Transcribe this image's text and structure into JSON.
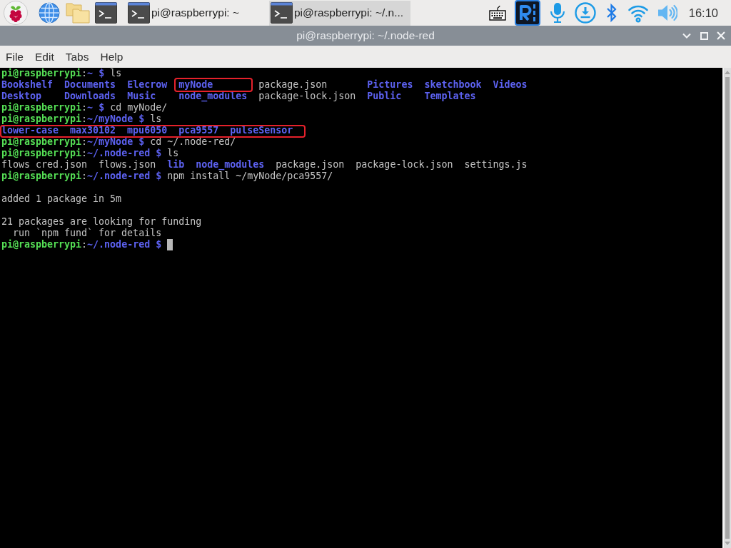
{
  "taskbar": {
    "windows": [
      {
        "label": "pi@raspberrypi: ~",
        "selected": false
      },
      {
        "label": "pi@raspberrypi: ~/.n...",
        "selected": true
      }
    ],
    "clock": "16:10"
  },
  "window": {
    "title": "pi@raspberrypi: ~/.node-red",
    "menu": [
      "File",
      "Edit",
      "Tabs",
      "Help"
    ]
  },
  "terminal": {
    "lines": [
      {
        "kind": "prompt",
        "highlighted": false,
        "prompt": {
          "user_host": "pi@raspberrypi",
          "separator": ":",
          "path": "~",
          "symbol": "$"
        },
        "command": "ls",
        "cursor": false
      },
      {
        "kind": "listing",
        "highlighted": false,
        "rows": [
          [
            {
              "name": "Bookshelf",
              "kind": "dir",
              "highlighted": false
            },
            {
              "name": "Documents",
              "kind": "dir",
              "highlighted": false
            },
            {
              "name": "Elecrow",
              "kind": "dir",
              "highlighted": false
            },
            {
              "name": "myNode",
              "kind": "dir",
              "highlighted": true
            },
            {
              "name": "package.json",
              "kind": "file",
              "highlighted": false
            },
            {
              "name": "Pictures",
              "kind": "dir",
              "highlighted": false
            },
            {
              "name": "sketchbook",
              "kind": "dir",
              "highlighted": false
            },
            {
              "name": "Videos",
              "kind": "dir",
              "highlighted": false
            }
          ],
          [
            {
              "name": "Desktop",
              "kind": "dir",
              "highlighted": false
            },
            {
              "name": "Downloads",
              "kind": "dir",
              "highlighted": false
            },
            {
              "name": "Music",
              "kind": "dir",
              "highlighted": false
            },
            {
              "name": "node_modules",
              "kind": "dir",
              "highlighted": false
            },
            {
              "name": "package-lock.json",
              "kind": "file",
              "highlighted": false
            },
            {
              "name": "Public",
              "kind": "dir",
              "highlighted": false
            },
            {
              "name": "Templates",
              "kind": "dir",
              "highlighted": false
            }
          ]
        ]
      },
      {
        "kind": "prompt",
        "highlighted": false,
        "prompt": {
          "user_host": "pi@raspberrypi",
          "separator": ":",
          "path": "~",
          "symbol": "$"
        },
        "command": "cd myNode/",
        "cursor": false
      },
      {
        "kind": "prompt",
        "highlighted": false,
        "prompt": {
          "user_host": "pi@raspberrypi",
          "separator": ":",
          "path": "~/myNode",
          "symbol": "$"
        },
        "command": "ls",
        "cursor": false
      },
      {
        "kind": "listing",
        "highlighted": true,
        "rows": [
          [
            {
              "name": "lower-case",
              "kind": "dir",
              "highlighted": false
            },
            {
              "name": "max30102",
              "kind": "dir",
              "highlighted": false
            },
            {
              "name": "mpu6050",
              "kind": "dir",
              "highlighted": false
            },
            {
              "name": "pca9557",
              "kind": "dir",
              "highlighted": false
            },
            {
              "name": "pulseSensor",
              "kind": "dir",
              "highlighted": false
            }
          ]
        ]
      },
      {
        "kind": "prompt",
        "highlighted": false,
        "prompt": {
          "user_host": "pi@raspberrypi",
          "separator": ":",
          "path": "~/myNode",
          "symbol": "$"
        },
        "command": "cd ~/.node-red/",
        "cursor": false
      },
      {
        "kind": "prompt",
        "highlighted": false,
        "prompt": {
          "user_host": "pi@raspberrypi",
          "separator": ":",
          "path": "~/.node-red",
          "symbol": "$"
        },
        "command": "ls",
        "cursor": false
      },
      {
        "kind": "listing",
        "highlighted": false,
        "rows": [
          [
            {
              "name": "flows_cred.json",
              "kind": "file",
              "highlighted": false
            },
            {
              "name": "flows.json",
              "kind": "file",
              "highlighted": false
            },
            {
              "name": "lib",
              "kind": "dir",
              "highlighted": false
            },
            {
              "name": "node_modules",
              "kind": "dir",
              "highlighted": false
            },
            {
              "name": "package.json",
              "kind": "file",
              "highlighted": false
            },
            {
              "name": "package-lock.json",
              "kind": "file",
              "highlighted": false
            },
            {
              "name": "settings.js",
              "kind": "file",
              "highlighted": false
            }
          ]
        ]
      },
      {
        "kind": "prompt",
        "highlighted": false,
        "prompt": {
          "user_host": "pi@raspberrypi",
          "separator": ":",
          "path": "~/.node-red",
          "symbol": "$"
        },
        "command": "npm install ~/myNode/pca9557/",
        "cursor": false
      },
      {
        "kind": "blank",
        "highlighted": false
      },
      {
        "kind": "output",
        "highlighted": false,
        "text": "added 1 package in 5m"
      },
      {
        "kind": "blank",
        "highlighted": false
      },
      {
        "kind": "output",
        "highlighted": false,
        "text": "21 packages are looking for funding"
      },
      {
        "kind": "output",
        "highlighted": false,
        "text": "  run `npm fund` for details"
      },
      {
        "kind": "prompt",
        "highlighted": false,
        "prompt": {
          "user_host": "pi@raspberrypi",
          "separator": ":",
          "path": "~/.node-red",
          "symbol": "$"
        },
        "cursor": true
      }
    ]
  }
}
